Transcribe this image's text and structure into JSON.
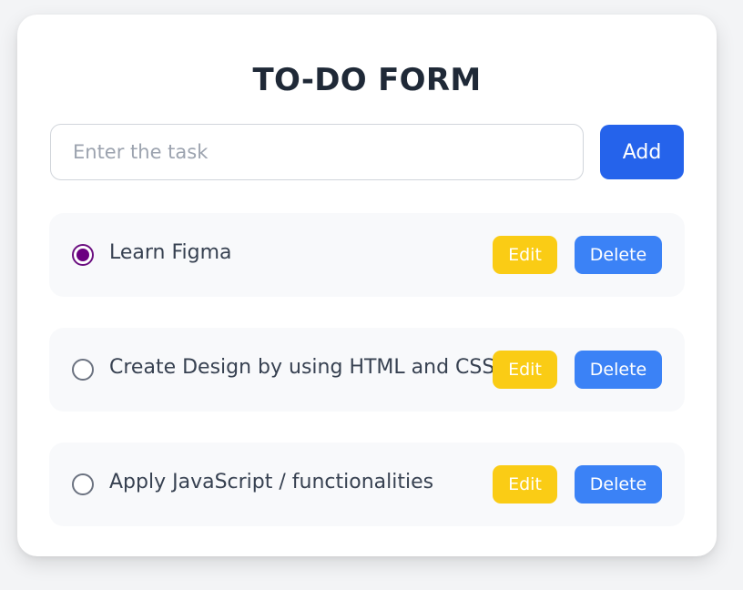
{
  "form": {
    "title": "TO-DO FORM",
    "input": {
      "placeholder": "Enter the task",
      "value": ""
    },
    "add_label": "Add"
  },
  "tasks": [
    {
      "text": "Learn Figma",
      "checked": true,
      "edit_label": "Edit",
      "delete_label": "Delete"
    },
    {
      "text": "Create Design by using HTML and CSS",
      "checked": false,
      "edit_label": "Edit",
      "delete_label": "Delete"
    },
    {
      "text": "Apply JavaScript / functionalities",
      "checked": false,
      "edit_label": "Edit",
      "delete_label": "Delete"
    }
  ],
  "colors": {
    "background": "#f3f4f6",
    "card": "#ffffff",
    "title": "#1f2937",
    "add_button": "#2563eb",
    "edit_button": "#facc15",
    "delete_button": "#3b82f6",
    "radio_checked": "#6b0080",
    "item_background": "#f8f9fb"
  }
}
